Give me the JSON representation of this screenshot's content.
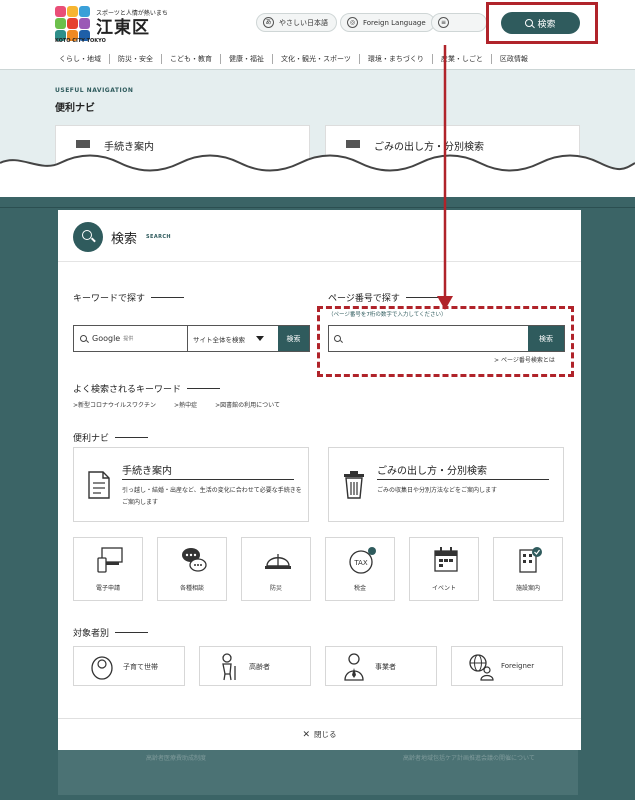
{
  "header": {
    "tagline": "スポーツと人情が熱いまち",
    "city_name": "江東区",
    "logo_sub": "KOTO CITY TOKYO",
    "easy_japanese": "やさしい日本語",
    "foreign_language": "Foreign Language",
    "search_button": "検索"
  },
  "global_nav": [
    "くらし・地域",
    "防災・安全",
    "こども・教育",
    "健康・福祉",
    "文化・観光・スポーツ",
    "環境・まちづくり",
    "産業・しごと",
    "区政情報"
  ],
  "useful_nav": {
    "heading_en": "USEFUL NAVIGATION",
    "heading": "便利ナビ",
    "cards": [
      "手続き案内",
      "ごみの出し方・分別検索"
    ]
  },
  "search_modal": {
    "title": "検索",
    "title_en": "SEARCH",
    "keyword": {
      "heading": "キーワードで探す",
      "google_label": "Google",
      "google_sub": "提供",
      "scope_select": "サイト全体を検索",
      "submit": "検索"
    },
    "page_number": {
      "heading": "ページ番号で探す",
      "hint": "（ページ番号を7桁の数字で入力してください）",
      "placeholder": "",
      "submit": "検索",
      "help_link": "ページ番号検索とは"
    },
    "popular": {
      "heading": "よく検索されるキーワード",
      "items": [
        "新型コロナウイルスワクチン",
        "熱中症",
        "図書館の利用について"
      ]
    },
    "convenience": {
      "heading": "便利ナビ",
      "cards": [
        {
          "title": "手続き案内",
          "desc": "引っ越し・結婚・出産など、生活の変化に合わせて必要な手続きをご案内します"
        },
        {
          "title": "ごみの出し方・分別検索",
          "desc": "ごみの収集日や分別方法などをご案内します"
        }
      ],
      "icons": [
        {
          "label": "電子申請",
          "icon": "pc-phone-icon"
        },
        {
          "label": "各種相談",
          "icon": "speech-bubble-icon"
        },
        {
          "label": "防災",
          "icon": "helmet-icon"
        },
        {
          "label": "税金",
          "icon": "tax-icon"
        },
        {
          "label": "イベント",
          "icon": "calendar-icon"
        },
        {
          "label": "施設案内",
          "icon": "building-icon"
        }
      ]
    },
    "target": {
      "heading": "対象者別",
      "items": [
        {
          "label": "子育て世帯",
          "icon": "baby-icon"
        },
        {
          "label": "高齢者",
          "icon": "elderly-icon"
        },
        {
          "label": "事業者",
          "icon": "business-person-icon"
        },
        {
          "label": "Foreigner",
          "icon": "foreigner-icon"
        }
      ]
    },
    "close": "閉じる"
  },
  "background_snippets": [
    "高齢者医療費助成制度",
    "高齢者地域包括ケア計画推進会議の開催について"
  ],
  "colors": {
    "brand": "#2f5b5d",
    "highlight": "#b0232a",
    "overlay": "#3b6466"
  }
}
